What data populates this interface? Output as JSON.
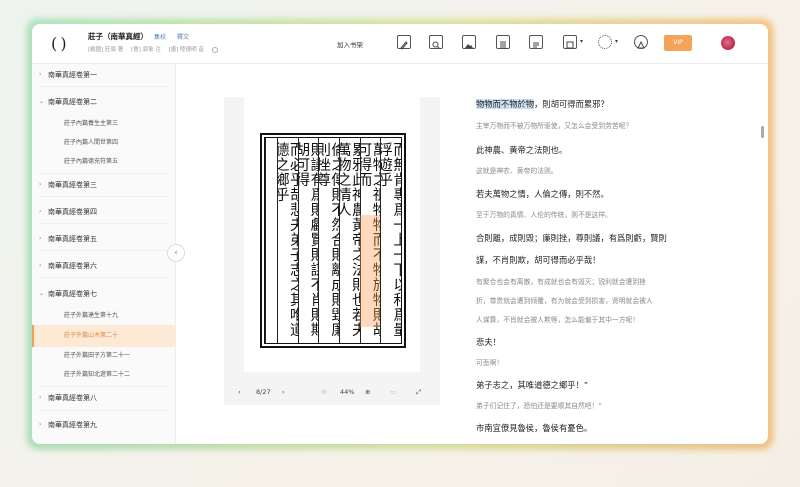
{
  "header": {
    "title": "莊子（南華真經）",
    "tags": [
      "集校",
      "釋文"
    ],
    "authors": [
      "[戰國] 莊周 著",
      "[晉] 郭象 注",
      "[唐] 陸德明 音"
    ],
    "add_shelf": "加入书架",
    "vip_label": "VIP",
    "icons": [
      "edit-icon",
      "search-icon",
      "image-icon",
      "columns-icon",
      "translate-icon",
      "font-icon",
      "settings-icon",
      "theme-icon"
    ]
  },
  "sidebar": {
    "items": [
      {
        "label": "南華真經卷第一",
        "level": 0,
        "caret": "›"
      },
      {
        "label": "南華真經卷第二",
        "level": 0,
        "caret": "⌄"
      },
      {
        "label": "莊子內篇養生主第三",
        "level": 1
      },
      {
        "label": "莊子內篇人間世第四",
        "level": 1
      },
      {
        "label": "莊子內篇德充符第五",
        "level": 1
      },
      {
        "label": "南華真經卷第三",
        "level": 0,
        "caret": "›"
      },
      {
        "label": "南華真經卷第四",
        "level": 0,
        "caret": "›"
      },
      {
        "label": "南華真經卷第五",
        "level": 0,
        "caret": "›"
      },
      {
        "label": "南華真經卷第六",
        "level": 0,
        "caret": "›"
      },
      {
        "label": "南華真經卷第七",
        "level": 0,
        "caret": "⌄"
      },
      {
        "label": "莊子外篇達生第十九",
        "level": 1
      },
      {
        "label": "莊子外篇山木第二十",
        "level": 1,
        "active": true
      },
      {
        "label": "莊子外篇田子方第二十一",
        "level": 1
      },
      {
        "label": "莊子外篇知北遊第二十二",
        "level": 1
      },
      {
        "label": "南華真經卷第八",
        "level": 0,
        "caret": "›"
      },
      {
        "label": "南華真經卷第九",
        "level": 0,
        "caret": "›"
      }
    ]
  },
  "scan": {
    "columns": [
      "而無肯專爲一上一下以和爲量浮遊乎",
      "萬物之祖物物而不物於物則胡可得而",
      "累邪此神農黃帝之法則也若夫萬物之情人",
      "倫之傳則不然合則離成則毀廉則挫尊",
      "則議有爲則虧賢則謀不肖則欺胡可得",
      "而必乎哉悲夫弟子志之其唯道德之鄉乎"
    ],
    "highlight_column": 1,
    "highlight_text": "物物而不物於物"
  },
  "viewer": {
    "page": "8/27",
    "zoom": "44%"
  },
  "text": {
    "lines": [
      {
        "kind": "orig",
        "hl": "物物而不物於物",
        "rest": "，則胡可得而累邪？"
      },
      {
        "kind": "trans",
        "text": "主宰万物而不被万物所驱使，又怎么会受到劳苦呢？"
      },
      {
        "kind": "orig",
        "text": "此神農、黄帝之法則也。"
      },
      {
        "kind": "trans",
        "text": "这就是神农、黄帝的法则。"
      },
      {
        "kind": "orig",
        "text": "若夫萬物之情，人倫之傳，則不然。"
      },
      {
        "kind": "trans",
        "text": "至于万物的真情、人伦的传统，则不是这样。"
      },
      {
        "kind": "orig",
        "text": "合則離，成則毀；廉則挫，尊則議，有爲則虧，賢則"
      },
      {
        "kind": "orig",
        "text": "謀，不肖則欺，胡可得而必乎哉！"
      },
      {
        "kind": "trans",
        "text": "有聚合也会有离散，有成就也会有毁灭；锐利就会遭到挫"
      },
      {
        "kind": "trans",
        "text": "折，尊贵就会遭到倾覆，有为就会受到损害，贤明就会被人"
      },
      {
        "kind": "trans",
        "text": "人谋算，不肖就会被人欺辱，怎么能偏于其中一方呢！"
      },
      {
        "kind": "orig",
        "text": "悲夫！"
      },
      {
        "kind": "trans",
        "text": "可悲啊！"
      },
      {
        "kind": "orig",
        "text": "弟子志之，其唯道德之鄉乎！”"
      },
      {
        "kind": "trans",
        "text": "弟子们记住了，恐怕还是要顺其自然吧！”"
      },
      {
        "kind": "orig",
        "text": "市南宜僚見魯侯，魯侯有憂色。"
      }
    ]
  }
}
